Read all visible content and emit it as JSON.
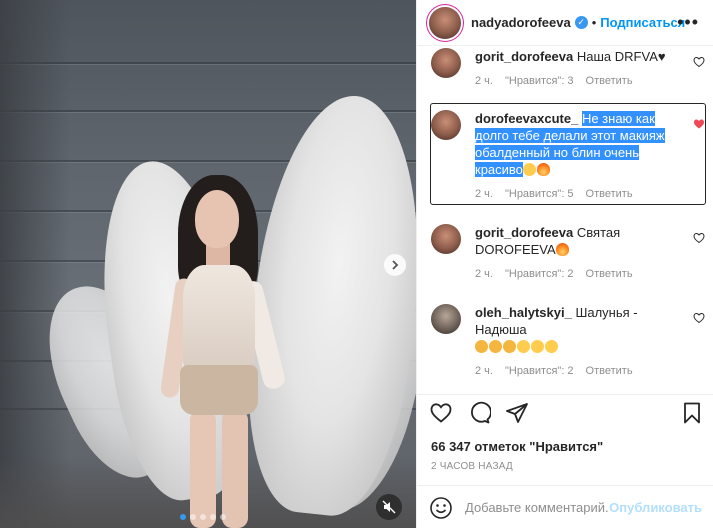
{
  "post": {
    "username": "nadyadorofeeva",
    "verified": true,
    "follow_label": "Подписаться",
    "more_label": "•••",
    "photo": {
      "slide_count": 5,
      "active_slide": 1
    }
  },
  "comments": [
    {
      "username": "gorit_dorofeeva",
      "text": "Наша DRFVA♥",
      "time": "2 ч.",
      "likes": "\"Нравится\": 3",
      "reply": "Ответить",
      "liked": false
    },
    {
      "username": "dorofeevaxcute_",
      "text": "Не знаю как долго тебе делали этот макияж обалденный но блин очень красиво",
      "time": "2 ч.",
      "likes": "\"Нравится\": 5",
      "reply": "Ответить",
      "liked": true
    },
    {
      "username": "gorit_dorofeeva",
      "text": "Святая DOROFEEVA",
      "time": "2 ч.",
      "likes": "\"Нравится\": 2",
      "reply": "Ответить",
      "liked": false
    },
    {
      "username": "oleh_halytskyi_",
      "text": "Шалунья - Надюша",
      "time": "2 ч.",
      "likes": "\"Нравится\": 2",
      "reply": "Ответить",
      "liked": false
    }
  ],
  "actions": {
    "likes_text": "66 347 отметок \"Нравится\"",
    "posted_ago": "2 ЧАСОВ НАЗАД",
    "comment_placeholder": "Добавьте комментарий...",
    "publish_label": "Опубликовать"
  },
  "colors": {
    "accent": "#0095f6",
    "heart_liked": "#ed4956",
    "selection": "#3390ff"
  }
}
